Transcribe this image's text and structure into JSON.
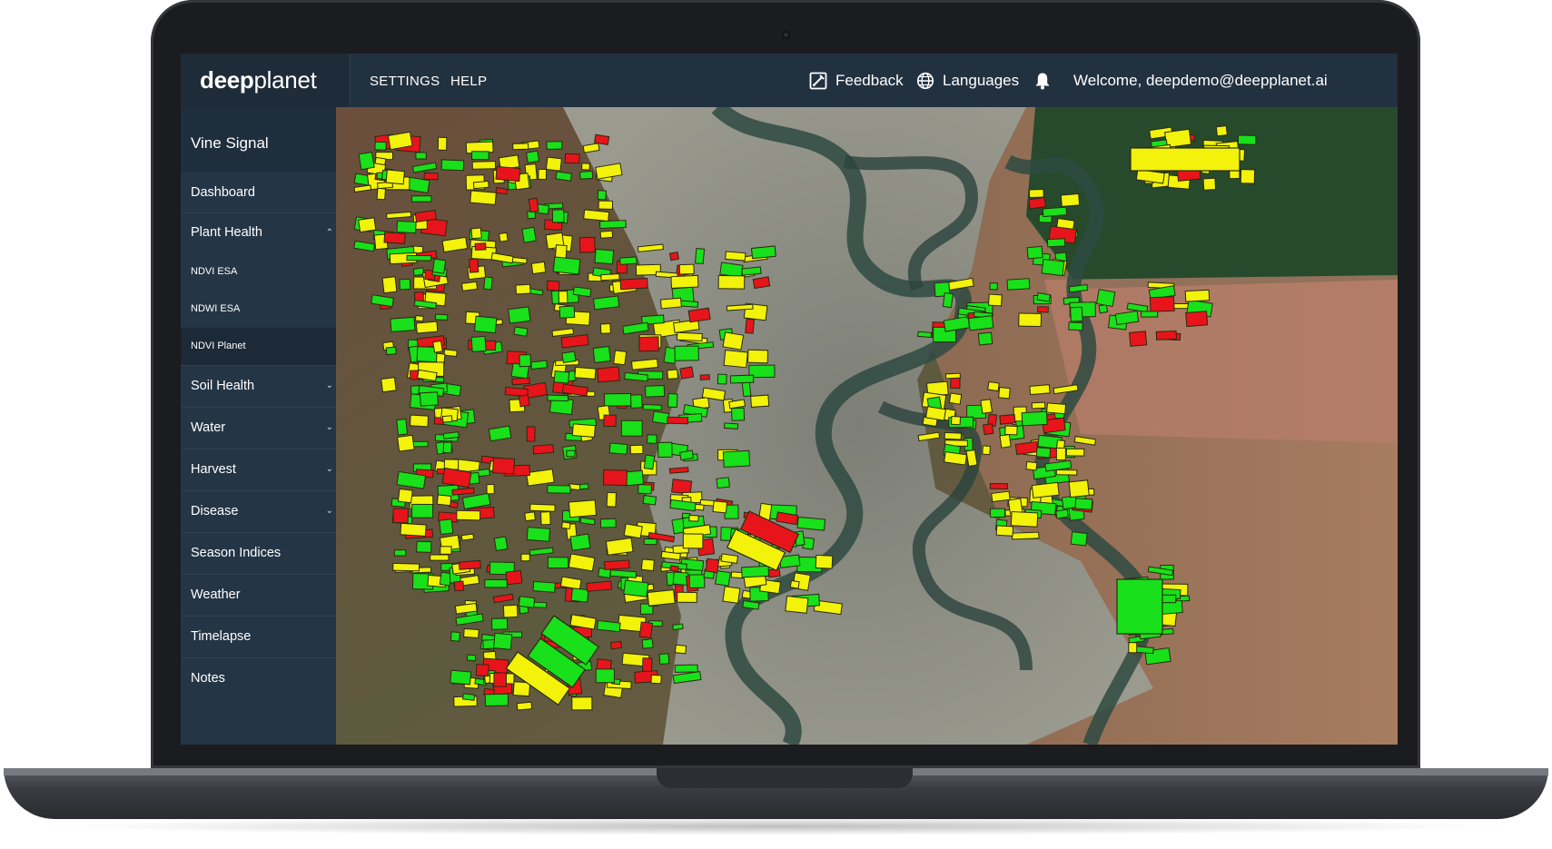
{
  "app": {
    "logo_bold": "deep",
    "logo_light": "planet"
  },
  "topbar": {
    "nav": [
      {
        "label": "SETTINGS"
      },
      {
        "label": "HELP"
      }
    ],
    "feedback_label": "Feedback",
    "languages_label": "Languages",
    "welcome_text": "Welcome, deepdemo@deepplanet.ai"
  },
  "sidebar": {
    "section_title": "Vine Signal",
    "items": [
      {
        "label": "Dashboard"
      },
      {
        "label": "Plant Health"
      },
      {
        "label": "NDVI ESA"
      },
      {
        "label": "NDWI ESA"
      },
      {
        "label": "NDVI Planet"
      },
      {
        "label": "Soil Health"
      },
      {
        "label": "Water"
      },
      {
        "label": "Harvest"
      },
      {
        "label": "Disease"
      },
      {
        "label": "Season Indices"
      },
      {
        "label": "Weather"
      },
      {
        "label": "Timelapse"
      },
      {
        "label": "Notes"
      }
    ],
    "active_item": "NDVI Planet"
  },
  "map": {
    "layer": "NDVI Planet",
    "field_status_colors": {
      "good": "#18e01a",
      "moderate": "#f2f20a",
      "poor": "#e8141b"
    }
  },
  "colors": {
    "topbar_bg": "#223140",
    "sidebar_bg": "#243546",
    "active_bg": "#1c2936"
  }
}
